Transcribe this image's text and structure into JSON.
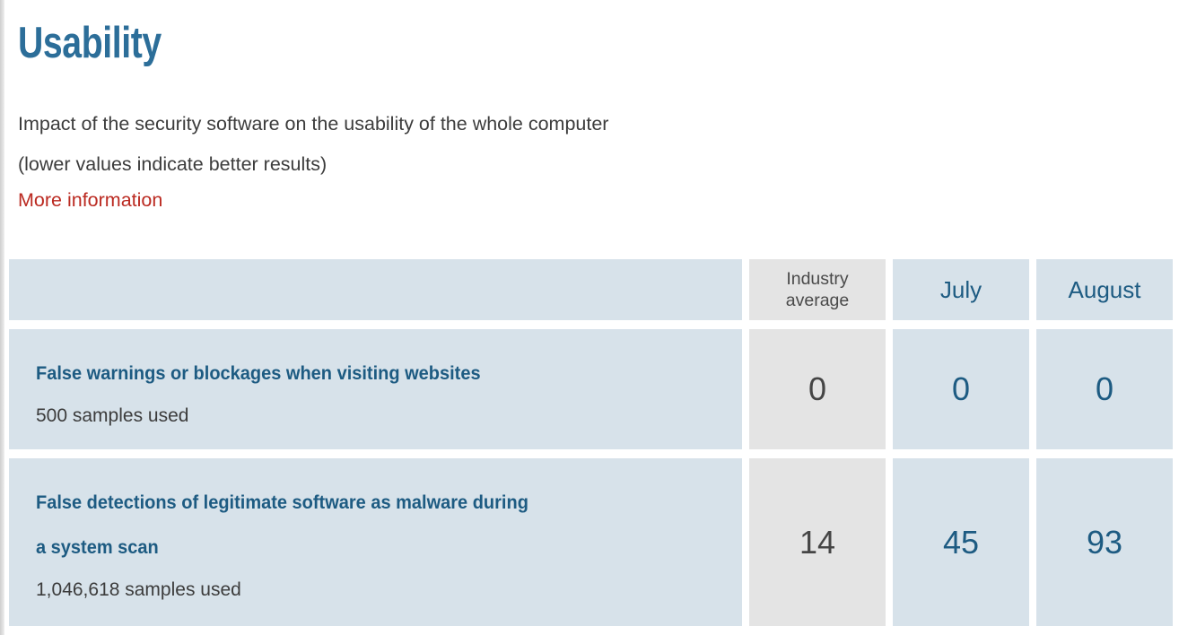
{
  "page": {
    "title": "Usability",
    "description_lines": [
      "Impact of the security software on the usability of the whole computer",
      "(lower values indicate better results)"
    ],
    "more_info_label": "More information"
  },
  "colors": {
    "title_blue": "#2c6e99",
    "link_red": "#bb2a21",
    "cell_blue_bg": "#d7e2ea",
    "cell_gray_bg": "#e4e4e4",
    "value_blue": "#1d5b82",
    "value_gray": "#454545",
    "text_gray": "#3c3c3c"
  },
  "table": {
    "columns": [
      {
        "id": "criterion",
        "label": ""
      },
      {
        "id": "industry_average",
        "label": "Industry average",
        "label_line1": "Industry",
        "label_line2": "average",
        "style": "gray"
      },
      {
        "id": "july",
        "label": "July",
        "style": "blue"
      },
      {
        "id": "august",
        "label": "August",
        "style": "blue"
      }
    ],
    "rows": [
      {
        "title": "False warnings or blockages when visiting websites",
        "samples": "500 samples used",
        "industry_average": "0",
        "july": "0",
        "august": "0"
      },
      {
        "title_line1": "False detections of legitimate software as malware during",
        "title_line2": "a system scan",
        "samples": "1,046,618 samples used",
        "industry_average": "14",
        "july": "45",
        "august": "93"
      }
    ]
  },
  "chart_data": {
    "type": "table",
    "title": "Usability",
    "subtitle": "Impact of the security software on the usability of the whole computer (lower values indicate better results)",
    "categories": [
      "False warnings or blockages when visiting websites",
      "False detections of legitimate software as malware during a system scan"
    ],
    "series": [
      {
        "name": "Industry average",
        "values": [
          0,
          14
        ]
      },
      {
        "name": "July",
        "values": [
          0,
          45
        ]
      },
      {
        "name": "August",
        "values": [
          0,
          93
        ]
      }
    ],
    "sample_counts": [
      "500 samples used",
      "1,046,618 samples used"
    ],
    "xlabel": "",
    "ylabel": "",
    "legend": "column headers"
  }
}
